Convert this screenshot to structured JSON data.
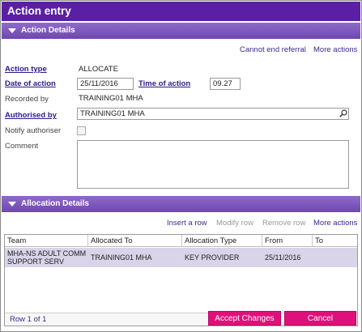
{
  "window": {
    "title": "Action entry"
  },
  "action_details": {
    "section_title": "Action Details",
    "cannot_end_referral": "Cannot end referral",
    "more_actions": "More actions",
    "action_type_label": "Action type",
    "action_type_value": "ALLOCATE",
    "date_of_action_label": "Date of action",
    "date_of_action_value": "25/11/2016",
    "time_of_action_label": "Time of action",
    "time_of_action_value": "09.27",
    "recorded_by_label": "Recorded by",
    "recorded_by_value": "TRAINING01 MHA",
    "authorised_by_label": "Authorised by",
    "authorised_by_value": "TRAINING01 MHA",
    "notify_authoriser_label": "Notify authoriser",
    "notify_authoriser_checked": false,
    "comment_label": "Comment",
    "comment_value": ""
  },
  "allocation_details": {
    "section_title": "Allocation Details",
    "insert_row": "Insert a row",
    "modify_row": "Modify row",
    "remove_row": "Remove row",
    "more_actions": "More actions",
    "columns": [
      "Team",
      "Allocated To",
      "Allocation Type",
      "From",
      "To"
    ],
    "rows": [
      {
        "team": "MHA-NS ADULT COMM SUPPORT SERV",
        "allocated_to": "TRAINING01 MHA",
        "allocation_type": "KEY PROVIDER",
        "from": "25/11/2016",
        "to": ""
      }
    ],
    "row_count_text": "Row 1 of 1"
  },
  "buttons": {
    "accept": "Accept Changes",
    "cancel": "Cancel"
  },
  "colors": {
    "title_bar": "#5b1fa6",
    "section_bar": "#7a55b8",
    "button": "#e0107a",
    "selected_row": "#d9d4e8"
  }
}
